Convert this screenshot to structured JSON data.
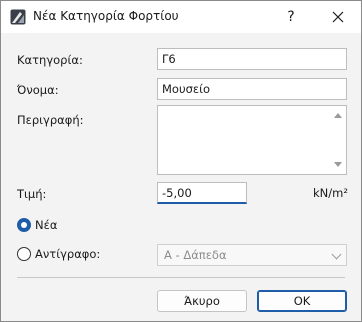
{
  "window": {
    "title": "Νέα Κατηγορία Φορτίου",
    "help_label": "?",
    "close_label": "×"
  },
  "form": {
    "category_label": "Κατηγορία:",
    "category_value": "Γ6",
    "name_label": "Όνομα:",
    "name_value": "Μουσείο",
    "description_label": "Περιγραφή:",
    "description_value": "",
    "value_label": "Τιμή:",
    "value_value": "-5,00",
    "unit": "kN/m²"
  },
  "options": {
    "new_label": "Νέα",
    "new_selected": true,
    "copy_label": "Αντίγραφο:",
    "copy_selected": false,
    "copy_source_value": "Α - Δάπεδα"
  },
  "buttons": {
    "cancel_label": "Άκυρο",
    "ok_label": "OK"
  },
  "colors": {
    "accent": "#1f5da8",
    "disabled_text": "#8c8c8c"
  }
}
